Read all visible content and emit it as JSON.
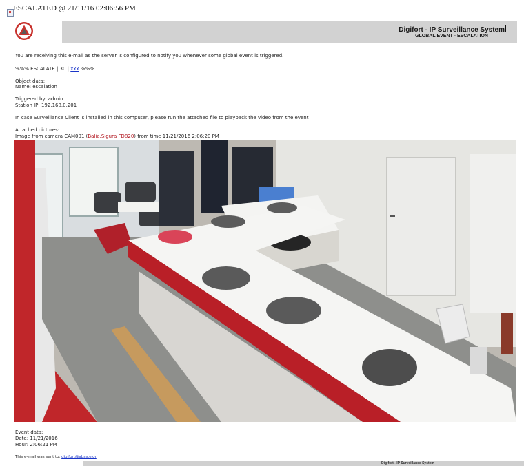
{
  "email": {
    "subject": "ESCALATED @ 21/11/16 02:06:56 PM"
  },
  "header": {
    "logo_icon": "digifort-triangle-logo",
    "title": "Digifort - IP Surveillance System",
    "subtitle": "GLOBAL EVENT - ESCALATION"
  },
  "body": {
    "intro": "You are receiving this e-mail as the server is configured to notify you whenever some global event is triggered.",
    "escalate_prefix": "%%% ESCALATE | 30 | ",
    "escalate_link": "xxx",
    "escalate_suffix": " %%%",
    "object_heading": "Object data:",
    "object_name": "Name: escalation",
    "triggered_by": "Triggered by: admin",
    "station_ip": "Station IP: 192.168.0.201",
    "client_note": "In case Surveillance Client is installed in this computer, please run the attached file to playback the video from the event",
    "attached_heading": "Attached pictures:",
    "image_caption_prefix": "Image from camera CAM001 (",
    "image_caption_camera": "Balia.Sigura FD820",
    "image_caption_suffix": ") from time 11/21/2016 2:06:20 PM",
    "event_heading": "Event data:",
    "event_date": "Date: 11/21/2016",
    "event_hour": "Hour: 2:06:21 PM",
    "sent_to_prefix": "This e-mail was sent to: ",
    "sent_to_link": "digifort@abas.elor"
  },
  "footer": {
    "brand": "Digifort - IP Surveillance System"
  },
  "colors": {
    "header_bar": "#d2d2d2",
    "logo_red": "#c8322d",
    "link_blue": "#1a35c8"
  }
}
